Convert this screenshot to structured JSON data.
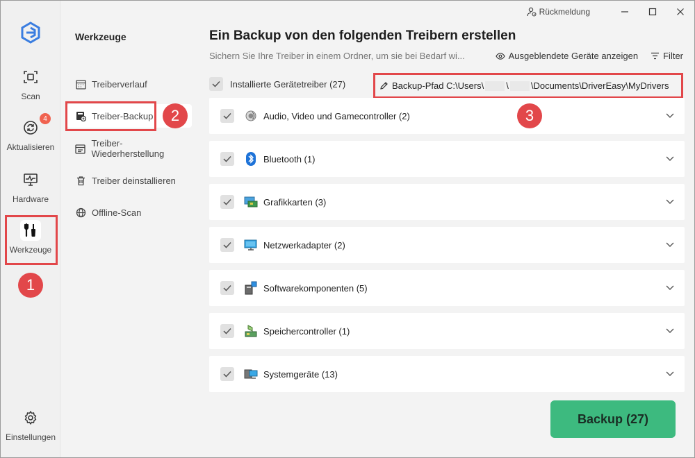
{
  "titlebar": {
    "feedback_label": "Rückmeldung"
  },
  "rail": {
    "items": [
      {
        "label": "Scan",
        "icon": "scan-icon"
      },
      {
        "label": "Aktualisieren",
        "icon": "refresh-icon",
        "badge": "4"
      },
      {
        "label": "Hardware",
        "icon": "hardware-monitor-icon"
      },
      {
        "label": "Werkzeuge",
        "icon": "tools-icon"
      },
      {
        "label": "Einstellungen",
        "icon": "gear-icon"
      }
    ]
  },
  "subnav": {
    "title": "Werkzeuge",
    "items": [
      {
        "label": "Treiberverlauf",
        "icon": "calendar-icon"
      },
      {
        "label": "Treiber-Backup",
        "icon": "backup-icon"
      },
      {
        "label": "Treiber-Wiederherstellung",
        "icon": "restore-icon"
      },
      {
        "label": "Treiber deinstallieren",
        "icon": "trash-icon"
      },
      {
        "label": "Offline-Scan",
        "icon": "globe-icon"
      }
    ]
  },
  "main": {
    "title": "Ein Backup von den folgenden Treibern erstellen",
    "subtitle": "Sichern Sie Ihre Treiber in einem Ordner, um sie bei Bedarf wi...",
    "show_hidden_label": "Ausgeblendete Geräte anzeigen",
    "filter_label": "Filter",
    "installed_label": "Installierte Gerätetreiber (27)",
    "path": {
      "prefix": "Backup-Pfad C:\\Users\\",
      "middle": "\\",
      "suffix": "\\Documents\\DriverEasy\\MyDrivers"
    },
    "categories": [
      {
        "label": "Audio, Video und Gamecontroller (2)",
        "icon": "speaker-icon"
      },
      {
        "label": "Bluetooth (1)",
        "icon": "bluetooth-icon"
      },
      {
        "label": "Grafikkarten (3)",
        "icon": "graphics-card-icon"
      },
      {
        "label": "Netzwerkadapter (2)",
        "icon": "network-adapter-icon"
      },
      {
        "label": "Softwarekomponenten (5)",
        "icon": "software-component-icon"
      },
      {
        "label": "Speichercontroller (1)",
        "icon": "storage-controller-icon"
      },
      {
        "label": "Systemgeräte (13)",
        "icon": "system-device-icon"
      }
    ],
    "backup_button": "Backup (27)"
  },
  "annotations": {
    "n1": "1",
    "n2": "2",
    "n3": "3"
  },
  "colors": {
    "accent_green": "#3dba7f",
    "annotation_red": "#e2474a",
    "badge_red": "#f0624f",
    "logo_blue": "#3a7de0"
  }
}
